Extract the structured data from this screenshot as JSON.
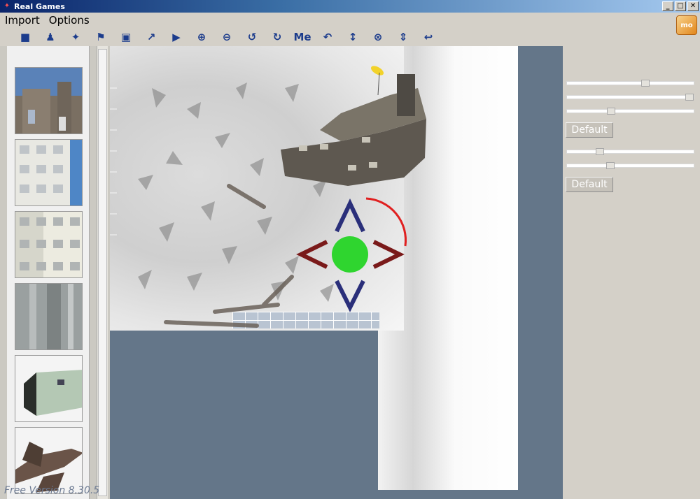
{
  "window": {
    "title": "Real Games",
    "min": "_",
    "max": "□",
    "close": "✕"
  },
  "menu": [
    "Import",
    "Options"
  ],
  "logo_text": "mo",
  "toolbar": [
    {
      "icon": "cube-icon",
      "glyph": "■"
    },
    {
      "icon": "figure-icon",
      "glyph": "♟"
    },
    {
      "icon": "magic-wand-icon",
      "glyph": "✦"
    },
    {
      "icon": "flag-icon",
      "glyph": "⚑"
    },
    {
      "icon": "save-icon",
      "glyph": "▣"
    },
    {
      "icon": "export-icon",
      "glyph": "↗"
    },
    {
      "icon": "play-icon",
      "glyph": "▶"
    },
    {
      "icon": "zoom-in-icon",
      "glyph": "⊕"
    },
    {
      "icon": "zoom-out-icon",
      "glyph": "⊖"
    },
    {
      "icon": "rotate-left-icon",
      "glyph": "↺"
    },
    {
      "icon": "rotate-right-icon",
      "glyph": "↻"
    },
    {
      "icon": "text-tool-icon",
      "glyph": "Me"
    },
    {
      "icon": "spin-icon",
      "glyph": "↶"
    },
    {
      "icon": "vertical-move-icon",
      "glyph": "↕"
    },
    {
      "icon": "close-circle-icon",
      "glyph": "⊗"
    },
    {
      "icon": "arrows-up-down-icon",
      "glyph": "⇕"
    },
    {
      "icon": "undo-icon",
      "glyph": "↩"
    }
  ],
  "version": "Free Version 8.30.5",
  "sliders": [
    0.63,
    1.0,
    0.34,
    0.24,
    0.33
  ],
  "default_label": "Default",
  "colors": {
    "viewport": "#647689",
    "gizmo_arrow_dark": "#2a2f7a",
    "gizmo_arrow_red": "#7a1a1a",
    "gizmo_center": "#2fd52f",
    "gizmo_arc": "#e02020"
  }
}
